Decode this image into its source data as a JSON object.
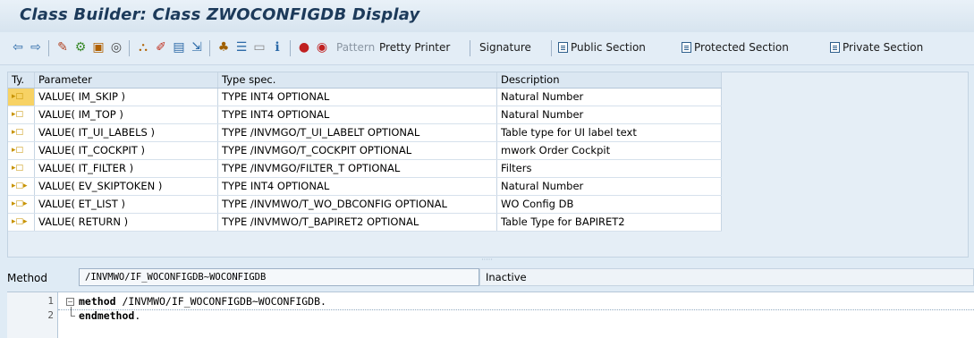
{
  "window": {
    "title": "Class Builder: Class ZWOCONFIGDB Display"
  },
  "toolbar": {
    "pattern_label": "Pattern",
    "pretty_printer_label": "Pretty Printer",
    "signature_label": "Signature",
    "public_section_label": "Public Section",
    "protected_section_label": "Protected Section",
    "private_section_label": "Private Section"
  },
  "params_table": {
    "headers": {
      "ty": "Ty.",
      "parameter": "Parameter",
      "type_spec": "Type spec.",
      "description": "Description"
    },
    "rows": [
      {
        "ty": "▸□",
        "parameter": "VALUE( IM_SKIP )",
        "type_spec": "TYPE INT4 OPTIONAL",
        "description": "Natural Number"
      },
      {
        "ty": "▸□",
        "parameter": "VALUE( IM_TOP )",
        "type_spec": "TYPE INT4 OPTIONAL",
        "description": "Natural Number"
      },
      {
        "ty": "▸□",
        "parameter": "VALUE( IT_UI_LABELS )",
        "type_spec": "TYPE /INVMGO/T_UI_LABELT OPTIONAL",
        "description": "Table type for UI label text"
      },
      {
        "ty": "▸□",
        "parameter": "VALUE( IT_COCKPIT )",
        "type_spec": "TYPE /INVMGO/T_COCKPIT OPTIONAL",
        "description": "mwork Order Cockpit"
      },
      {
        "ty": "▸□",
        "parameter": "VALUE( IT_FILTER )",
        "type_spec": "TYPE /INVMGO/FILTER_T OPTIONAL",
        "description": "Filters"
      },
      {
        "ty": "▸□▸",
        "parameter": "VALUE( EV_SKIPTOKEN )",
        "type_spec": "TYPE INT4 OPTIONAL",
        "description": "Natural Number"
      },
      {
        "ty": "▸□▸",
        "parameter": "VALUE( ET_LIST )",
        "type_spec": "TYPE /INVMWO/T_WO_DBCONFIG OPTIONAL",
        "description": "WO Config DB"
      },
      {
        "ty": "▸□▸",
        "parameter": "VALUE( RETURN )",
        "type_spec": "TYPE /INVMWO/T_BAPIRET2 OPTIONAL",
        "description": "Table Type for BAPIRET2"
      }
    ]
  },
  "method_bar": {
    "label": "Method",
    "value": "/INVMWO/IF_WOCONFIGDB~WOCONFIGDB",
    "status": "Inactive"
  },
  "editor": {
    "lines": [
      {
        "num": "1",
        "keyword": "method",
        "rest": " /INVMWO/IF_WOCONFIGDB~WOCONFIGDB."
      },
      {
        "num": "2",
        "keyword": "endmethod",
        "rest": "."
      }
    ]
  }
}
